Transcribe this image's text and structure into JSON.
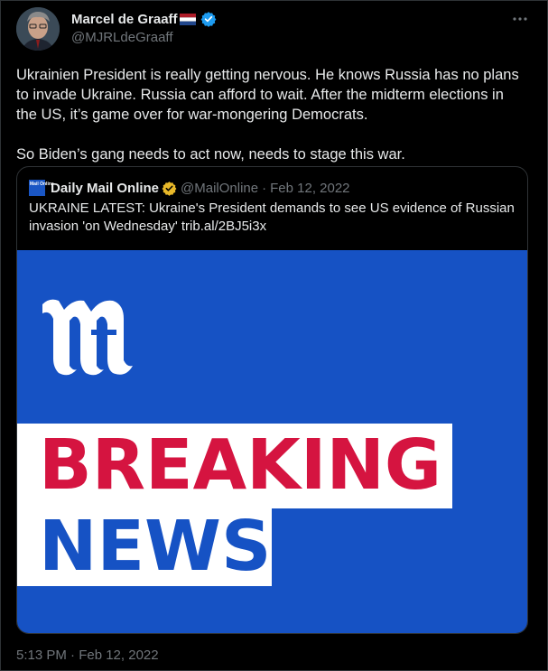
{
  "author": {
    "name": "Marcel de Graaff",
    "handle": "@MJRLdeGraaff",
    "flag_icon": "netherlands-flag-icon",
    "verified_icon": "verified-badge-icon"
  },
  "tweet": {
    "paragraphs": [
      "Ukrainien President is really getting nervous. He knows Russia has no plans to invade Ukraine. Russia can afford to wait. After the midterm elections in the US, it’s game over for war-mongering Democrats.",
      "So Biden’s gang needs to act now, needs to stage this war."
    ],
    "timestamp": "5:13 PM · Feb 12, 2022"
  },
  "quoted": {
    "logo_text": "Mail Online",
    "name": "Daily Mail Online",
    "handle": "@MailOnline",
    "date": "Feb 12, 2022",
    "separator": "·",
    "text": "UKRAINE LATEST: Ukraine's President demands to see US evidence of Russian invasion 'on Wednesday' trib.al/2BJ5i3x",
    "image": {
      "line1": "BREAKING",
      "line2": "NEWS"
    }
  },
  "colors": {
    "background": "#000000",
    "text": "#e7e9ea",
    "muted": "#71767b",
    "border": "#2f3336",
    "verified_blue": "#1d9bf0",
    "gold_badge": "#e8b829",
    "image_blue": "#1652c4",
    "breaking_red": "#d51440"
  }
}
